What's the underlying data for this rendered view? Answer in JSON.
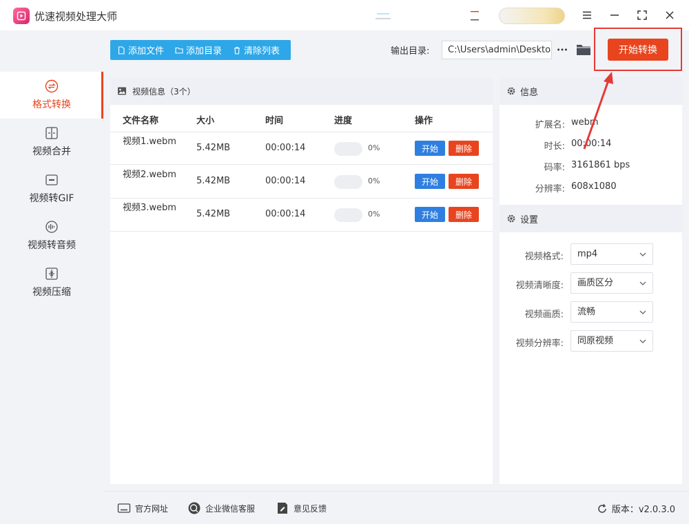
{
  "app": {
    "title": "优速视频处理大师"
  },
  "sidebar": {
    "items": [
      {
        "label": "格式转换",
        "icon": "format-convert-icon",
        "active": true
      },
      {
        "label": "视频合并",
        "icon": "merge-icon",
        "active": false
      },
      {
        "label": "视频转GIF",
        "icon": "gif-icon",
        "active": false
      },
      {
        "label": "视频转音频",
        "icon": "audio-icon",
        "active": false
      },
      {
        "label": "视频压缩",
        "icon": "compress-icon",
        "active": false
      }
    ]
  },
  "toolbar": {
    "add_file": "添加文件",
    "add_dir": "添加目录",
    "clear_list": "清除列表",
    "output_label": "输出目录:",
    "output_path": "C:\\Users\\admin\\Desktop",
    "start_all": "开始转换"
  },
  "list": {
    "header": "视频信息（3个）",
    "columns": [
      "文件名称",
      "大小",
      "时间",
      "进度",
      "操作"
    ],
    "rows": [
      {
        "name": "视频1.webm",
        "size": "5.42MB",
        "time": "00:00:14",
        "progress": 0,
        "progress_label": "0%",
        "start": "开始",
        "delete": "删除"
      },
      {
        "name": "视频2.webm",
        "size": "5.42MB",
        "time": "00:00:14",
        "progress": 0,
        "progress_label": "0%",
        "start": "开始",
        "delete": "删除"
      },
      {
        "name": "视频3.webm",
        "size": "5.42MB",
        "time": "00:00:14",
        "progress": 0,
        "progress_label": "0%",
        "start": "开始",
        "delete": "删除"
      }
    ]
  },
  "info": {
    "title": "信息",
    "ext_label": "扩展名:",
    "ext": "webm",
    "duration_label": "时长:",
    "duration": "00:00:14",
    "bitrate_label": "码率:",
    "bitrate": "3161861 bps",
    "resolution_label": "分辨率:",
    "resolution": "608x1080"
  },
  "settings": {
    "title": "设置",
    "format_label": "视频格式:",
    "format": "mp4",
    "clarity_label": "视频清晰度:",
    "clarity": "画质区分",
    "quality_label": "视频画质:",
    "quality": "流畅",
    "resolution_label": "视频分辨率:",
    "resolution": "同原视频"
  },
  "footer": {
    "website": "官方网址",
    "wechat": "企业微信客服",
    "feedback": "意见反馈",
    "version": "版本：v2.0.3.0"
  },
  "colors": {
    "accent": "#e8451f",
    "blue": "#2ea7e8",
    "start_btn": "#2f7fe0",
    "annotation": "#e53935"
  }
}
